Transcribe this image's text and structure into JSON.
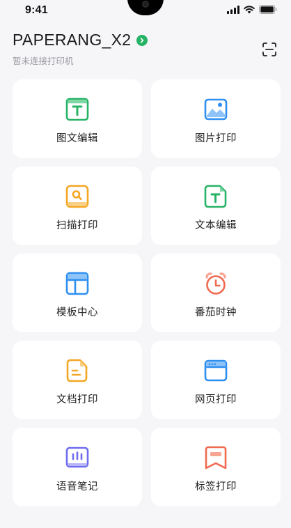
{
  "status_bar": {
    "time": "9:41"
  },
  "header": {
    "device_name": "PAPERANG_X2",
    "connection_status": "暂未连接打印机"
  },
  "features": [
    {
      "label": "图文编辑",
      "icon": "text-image-icon",
      "color": "#27b366"
    },
    {
      "label": "图片打印",
      "icon": "picture-icon",
      "color": "#2e8ff0"
    },
    {
      "label": "扫描打印",
      "icon": "scan-search-icon",
      "color": "#f5a623"
    },
    {
      "label": "文本编辑",
      "icon": "text-document-icon",
      "color": "#27b366"
    },
    {
      "label": "模板中心",
      "icon": "template-layout-icon",
      "color": "#2e8ff0"
    },
    {
      "label": "番茄时钟",
      "icon": "alarm-clock-icon",
      "color": "#f06a50"
    },
    {
      "label": "文档打印",
      "icon": "document-icon",
      "color": "#f5a623"
    },
    {
      "label": "网页打印",
      "icon": "browser-window-icon",
      "color": "#2e8ff0"
    },
    {
      "label": "语音笔记",
      "icon": "voice-note-icon",
      "color": "#6f6cf0"
    },
    {
      "label": "标签打印",
      "icon": "label-tag-icon",
      "color": "#f06a50"
    }
  ]
}
